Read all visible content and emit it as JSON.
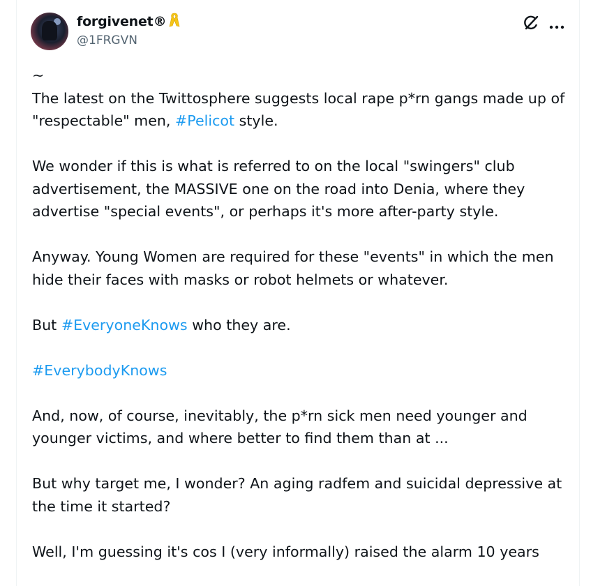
{
  "author": {
    "display_name": "forgivenet®",
    "handle": "@1FRGVN",
    "badge_icon": "yellow-ribbon-icon"
  },
  "actions": {
    "grok_icon": "grok-icon",
    "more_icon": "more-icon"
  },
  "post": {
    "tilde": "~",
    "p1_a": "The latest on the Twittosphere suggests local rape p*rn gangs made up of \"respectable\" men, ",
    "p1_tag": "#Pelicot",
    "p1_b": " style.",
    "p2": "We wonder if this is what is referred to on the local \"swingers\" club advertisement, the MASSIVE one on the road into Denia, where they advertise \"special events\", or perhaps it's more after-party style.",
    "p3": "Anyway. Young Women are required for these \"events\" in which the men hide their faces with masks or robot helmets or whatever.",
    "p4_a": "But ",
    "p4_tag": "#EveryoneKnows",
    "p4_b": " who they are.",
    "p5_tag": "#EverybodyKnows",
    "p6": "And, now, of course, inevitably, the p*rn sick men need younger and younger victims, and where better to find them than at ...",
    "p7": "But why target me, I wonder? An aging radfem and suicidal depressive at the time it started?",
    "p8": "Well, I'm guessing it's cos I (very informally) raised the alarm 10 years"
  },
  "colors": {
    "text": "#0f1419",
    "secondary": "#536471",
    "link": "#1d9bf0",
    "ribbon": "#f5c518"
  }
}
